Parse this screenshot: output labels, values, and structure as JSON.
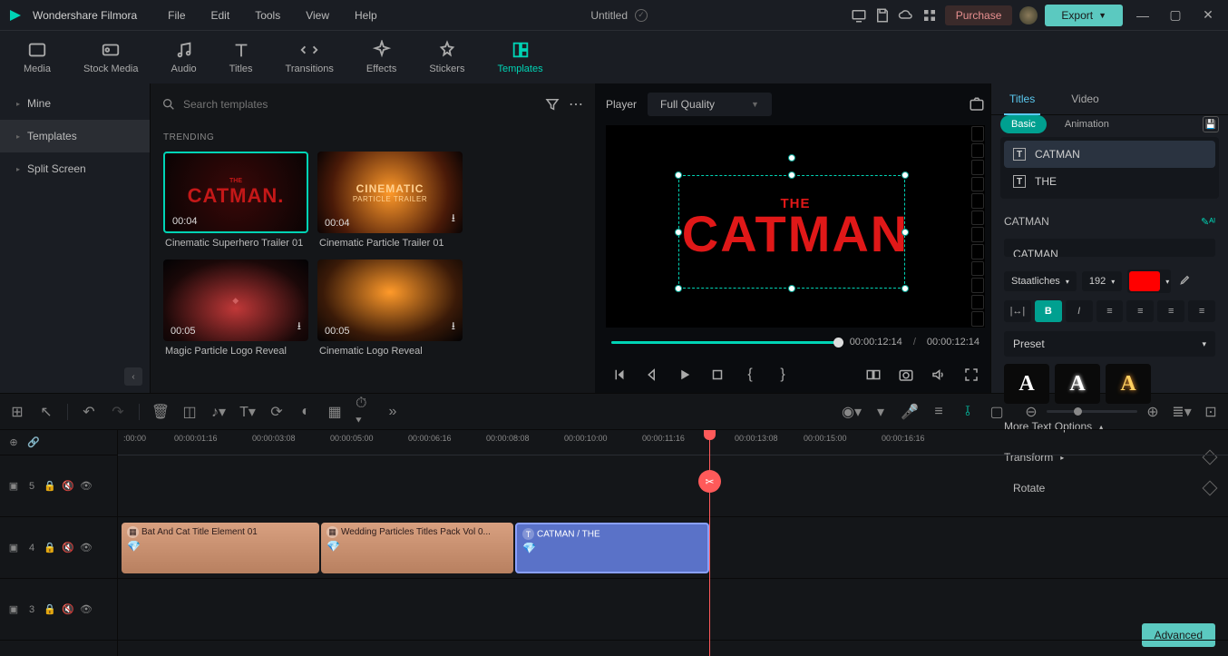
{
  "app": {
    "name": "Wondershare Filmora"
  },
  "menu": {
    "file": "File",
    "edit": "Edit",
    "tools": "Tools",
    "view": "View",
    "help": "Help"
  },
  "project": {
    "title": "Untitled"
  },
  "titlebar": {
    "purchase": "Purchase",
    "export": "Export"
  },
  "tabs": {
    "media": "Media",
    "stock": "Stock Media",
    "audio": "Audio",
    "titles": "Titles",
    "transitions": "Transitions",
    "effects": "Effects",
    "stickers": "Stickers",
    "templates": "Templates"
  },
  "sidebar": {
    "mine": "Mine",
    "templates": "Templates",
    "split": "Split Screen"
  },
  "search": {
    "placeholder": "Search templates"
  },
  "section": {
    "trending": "TRENDING"
  },
  "templates": [
    {
      "name": "Cinematic Superhero Trailer 01",
      "dur": "00:04"
    },
    {
      "name": "Cinematic Particle Trailer 01",
      "dur": "00:04"
    },
    {
      "name": "Magic Particle Logo Reveal",
      "dur": "00:05"
    },
    {
      "name": "Cinematic Logo Reveal",
      "dur": "00:05"
    }
  ],
  "player": {
    "label": "Player",
    "quality": "Full Quality",
    "time_cur": "00:00:12:14",
    "time_total": "00:00:12:14",
    "preview_the": "THE",
    "preview_main": "CATMAN"
  },
  "rpanel": {
    "tab_titles": "Titles",
    "tab_video": "Video",
    "sub_basic": "Basic",
    "sub_anim": "Animation",
    "layer1": "CATMAN",
    "layer2": "THE",
    "editing": "CATMAN",
    "text_value": "CATMAN",
    "font": "Staatliches",
    "size": "192",
    "color": "#ff0000",
    "preset": "Preset",
    "more_text": "More Text Options",
    "transform": "Transform",
    "rotate": "Rotate",
    "advanced": "Advanced"
  },
  "ruler": [
    ":00:00",
    "00:00:01:16",
    "00:00:03:08",
    "00:00:05:00",
    "00:00:06:16",
    "00:00:08:08",
    "00:00:10:00",
    "00:00:11:16",
    "00:00:13:08",
    "00:00:15:00",
    "00:00:16:16"
  ],
  "tracks": {
    "t5": "5",
    "t4": "4",
    "t3": "3"
  },
  "clips": {
    "c1": "Bat And Cat Title Element 01",
    "c2": "Wedding Particles Titles Pack Vol 0...",
    "c3": "CATMAN / THE"
  }
}
